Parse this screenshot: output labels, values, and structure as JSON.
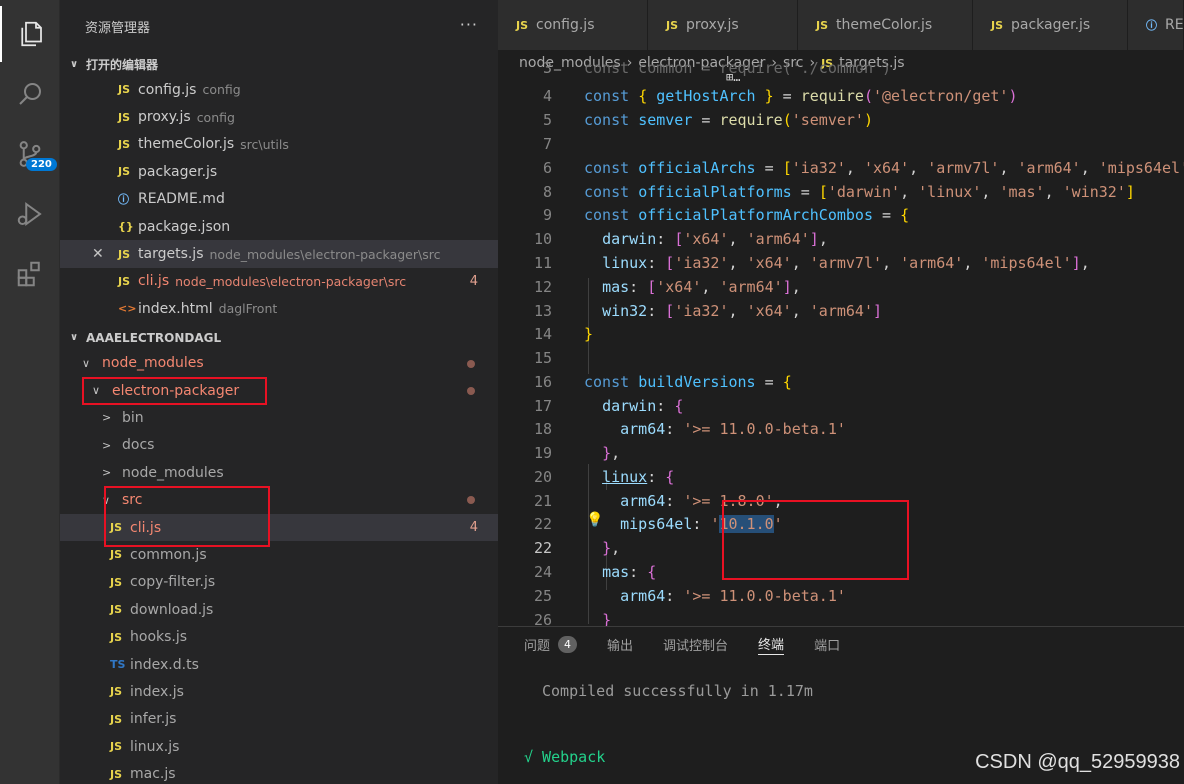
{
  "activity": {
    "scm_badge": "220"
  },
  "sidebar": {
    "title": "资源管理器",
    "more": "···",
    "open_editors": {
      "header": "打开的编辑器",
      "items": [
        {
          "icon": "JS",
          "name": "config.js",
          "desc": "config"
        },
        {
          "icon": "JS",
          "name": "proxy.js",
          "desc": "config"
        },
        {
          "icon": "JS",
          "name": "themeColor.js",
          "desc": "src\\utils"
        },
        {
          "icon": "JS",
          "name": "packager.js",
          "desc": ""
        },
        {
          "icon": "ⓘ",
          "name": "README.md",
          "desc": ""
        },
        {
          "icon": "{}",
          "name": "package.json",
          "desc": ""
        },
        {
          "icon": "JS",
          "name": "targets.js",
          "desc": "node_modules\\electron-packager\\src",
          "close": "✕"
        },
        {
          "icon": "JS",
          "name": "cli.js",
          "desc": "node_modules\\electron-packager\\src",
          "count": "4"
        },
        {
          "icon": "<>",
          "name": "index.html",
          "desc": "daglFront"
        }
      ]
    },
    "project": {
      "header": "AAAELECTRONDAGL",
      "tree": [
        {
          "name": "node_modules",
          "chev": "∨"
        },
        {
          "name": "electron-packager",
          "chev": "∨"
        },
        {
          "name": "bin",
          "chev": ">"
        },
        {
          "name": "docs",
          "chev": ">"
        },
        {
          "name": "node_modules",
          "chev": ">"
        },
        {
          "name": "src",
          "chev": "∨"
        },
        {
          "icon": "JS",
          "name": "cli.js",
          "count": "4"
        },
        {
          "icon": "JS",
          "name": "common.js"
        },
        {
          "icon": "JS",
          "name": "copy-filter.js"
        },
        {
          "icon": "JS",
          "name": "download.js"
        },
        {
          "icon": "JS",
          "name": "hooks.js"
        },
        {
          "icon": "TS",
          "name": "index.d.ts"
        },
        {
          "icon": "JS",
          "name": "index.js"
        },
        {
          "icon": "JS",
          "name": "infer.js"
        },
        {
          "icon": "JS",
          "name": "linux.js"
        },
        {
          "icon": "JS",
          "name": "mac.js"
        }
      ]
    }
  },
  "tabs": [
    {
      "icon": "JS",
      "label": "config.js"
    },
    {
      "icon": "JS",
      "label": "proxy.js"
    },
    {
      "icon": "JS",
      "label": "themeColor.js"
    },
    {
      "icon": "JS",
      "label": "packager.js"
    },
    {
      "icon": "ⓘ",
      "label": "RE"
    }
  ],
  "breadcrumb": {
    "parts": [
      "node_modules",
      "electron-packager",
      "src"
    ],
    "file_icon": "JS",
    "file": "targets.js"
  },
  "editor": {
    "line_numbers": [
      "3",
      "4",
      "5",
      "6",
      "7",
      "8",
      "9",
      "10",
      "11",
      "12",
      "13",
      "14",
      "15",
      "16",
      "17",
      "18",
      "19",
      "20",
      "21",
      "22",
      "23",
      "24",
      "25",
      "26"
    ],
    "current_line": "22",
    "partial_line": "const common = require('./common')",
    "hover_hint": "⊞…"
  },
  "panel": {
    "tabs": [
      {
        "label": "问题",
        "badge": "4"
      },
      {
        "label": "输出"
      },
      {
        "label": "调试控制台"
      },
      {
        "label": "终端",
        "active": true
      },
      {
        "label": "端口"
      }
    ],
    "terminal_line1": "Compiled successfully in 1.17m",
    "terminal_line2": "√ Webpack"
  },
  "watermark": "CSDN @qq_52959938"
}
